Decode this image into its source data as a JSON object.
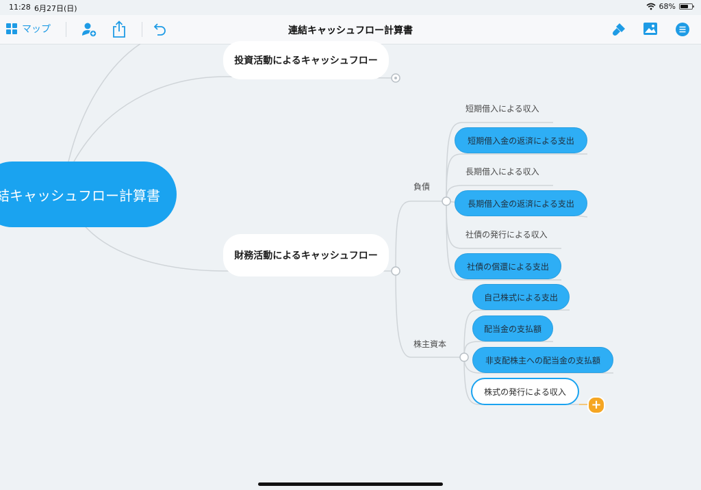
{
  "status": {
    "time": "11:28",
    "date": "6月27日(日)",
    "battery": "68%"
  },
  "toolbar": {
    "map_label": "マップ",
    "title": "連結キャッシュフロー計算書"
  },
  "mindmap": {
    "root": "結キャッシュフロー計算書",
    "investing": "投資活動によるキャッシュフロー",
    "financing": "財務活動によるキャッシュフロー",
    "liabilities": {
      "label": "負債",
      "items": [
        "短期借入による収入",
        "短期借入金の返済による支出",
        "長期借入による収入",
        "長期借入金の返済による支出",
        "社債の発行による収入",
        "社債の償還による支出"
      ]
    },
    "equity": {
      "label": "株主資本",
      "items": [
        "自己株式による支出",
        "配当金の支払額",
        "非支配株主への配当金の支払額",
        "株式の発行による収入"
      ]
    }
  },
  "colors": {
    "accent": "#1aa3f0",
    "add": "#f5a623"
  }
}
